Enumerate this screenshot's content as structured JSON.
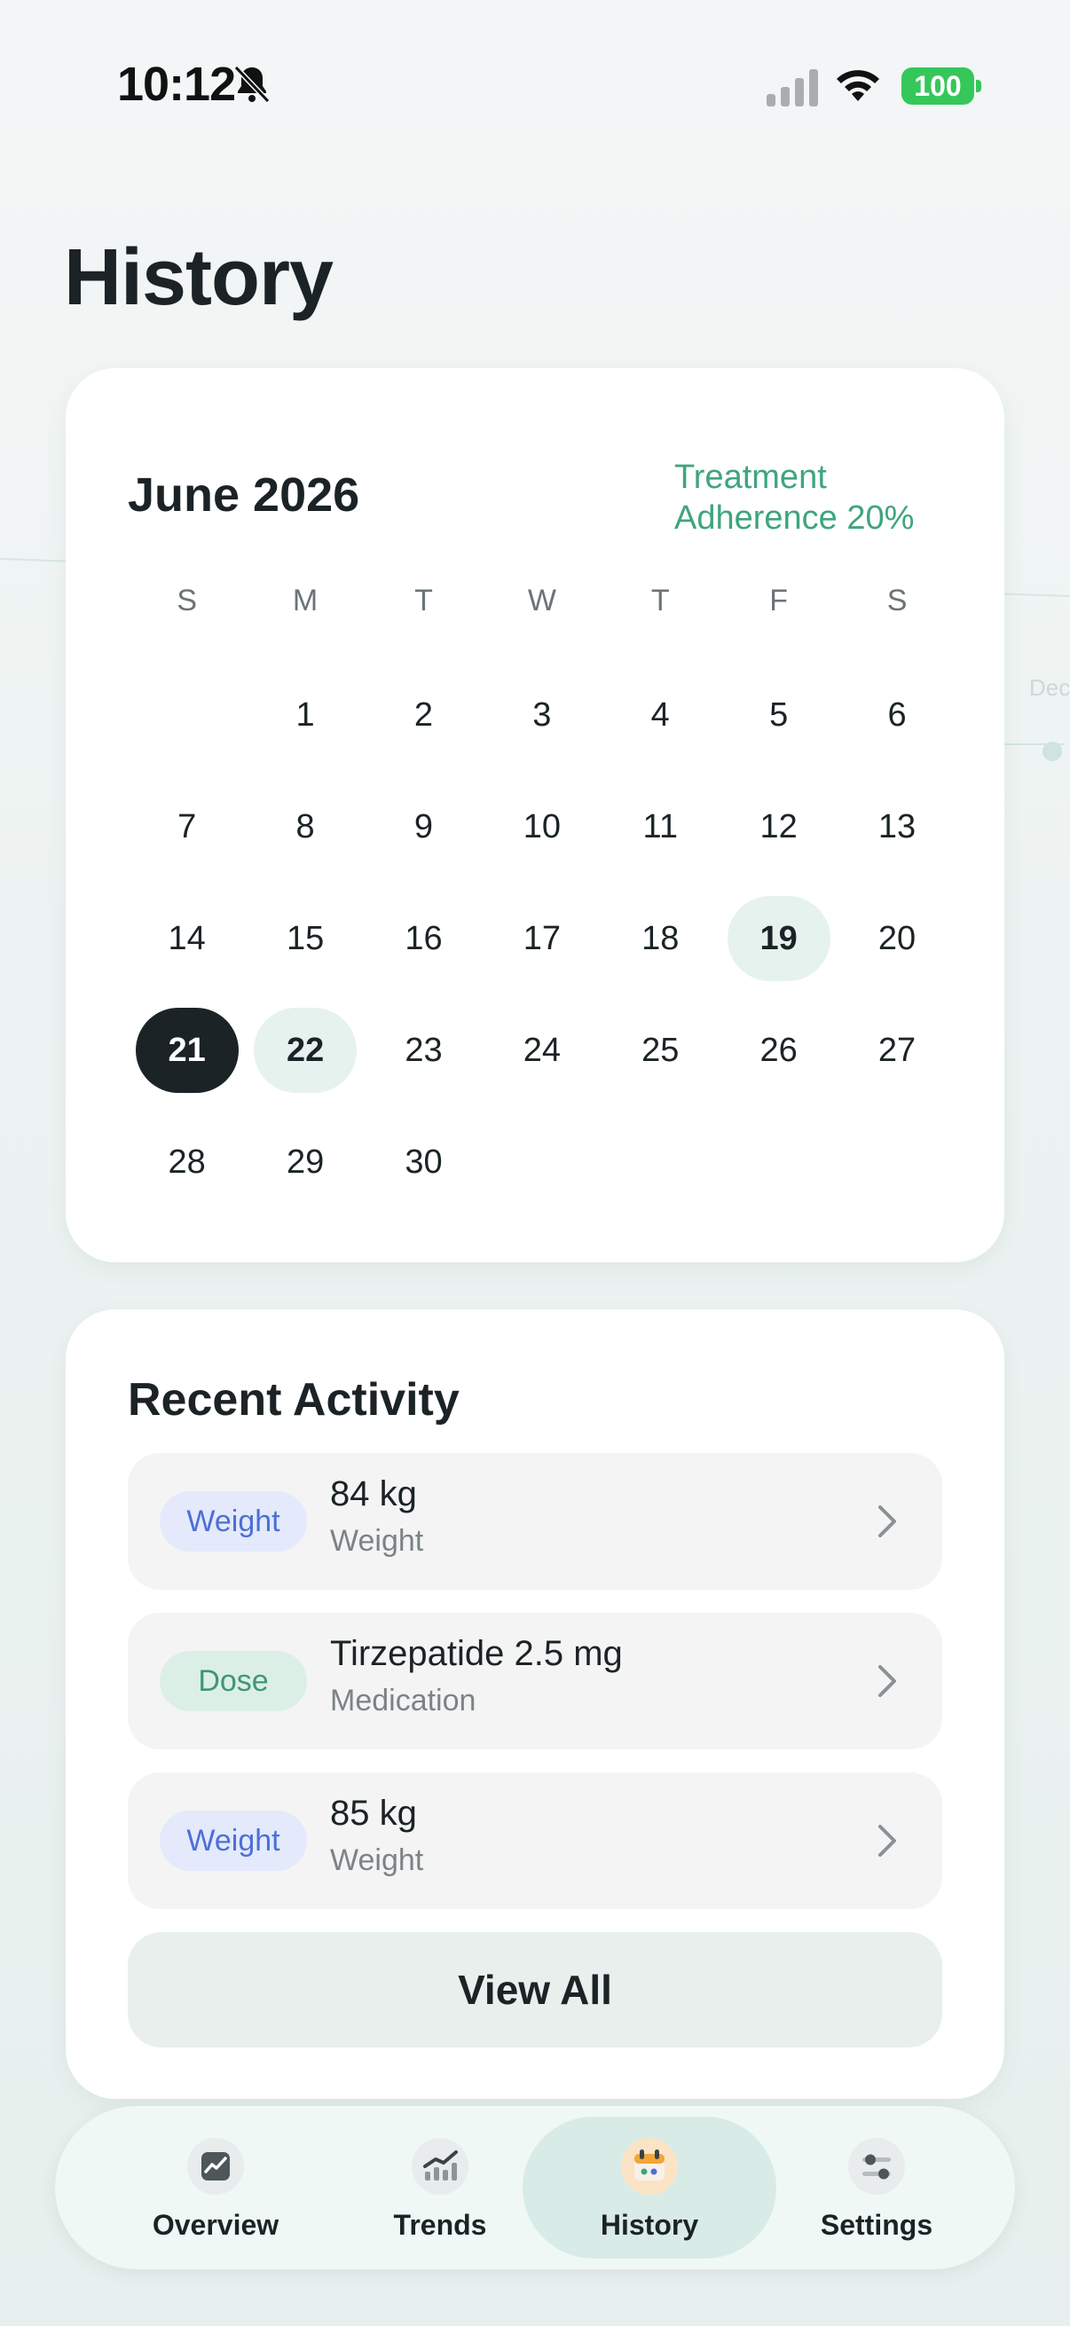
{
  "status_bar": {
    "time": "10:12",
    "battery": "100"
  },
  "page": {
    "title": "History"
  },
  "calendar": {
    "month_label": "June 2026",
    "adherence": "Treatment Adherence 20%",
    "weekdays": [
      "S",
      "M",
      "T",
      "W",
      "T",
      "F",
      "S"
    ],
    "weeks": [
      [
        "",
        "1",
        "2",
        "3",
        "4",
        "5",
        "6"
      ],
      [
        "7",
        "8",
        "9",
        "10",
        "11",
        "12",
        "13"
      ],
      [
        "14",
        "15",
        "16",
        "17",
        "18",
        "19",
        "20"
      ],
      [
        "21",
        "22",
        "23",
        "24",
        "25",
        "26",
        "27"
      ],
      [
        "28",
        "29",
        "30",
        "",
        "",
        "",
        ""
      ]
    ],
    "selected_day": "21",
    "highlighted_days": [
      "19",
      "22"
    ]
  },
  "recent_activity": {
    "title": "Recent Activity",
    "items": [
      {
        "tag": "Weight",
        "tag_type": "weight",
        "value": "84 kg",
        "category": "Weight"
      },
      {
        "tag": "Dose",
        "tag_type": "dose",
        "value": "Tirzepatide 2.5 mg",
        "category": "Medication"
      },
      {
        "tag": "Weight",
        "tag_type": "weight",
        "value": "85 kg",
        "category": "Weight"
      }
    ],
    "view_all_label": "View All"
  },
  "nav": {
    "items": [
      {
        "label": "Overview",
        "icon": "overview-chart-icon"
      },
      {
        "label": "Trends",
        "icon": "trends-chart-icon"
      },
      {
        "label": "History",
        "icon": "history-calendar-icon"
      },
      {
        "label": "Settings",
        "icon": "settings-sliders-icon"
      }
    ],
    "active": "History"
  },
  "colors": {
    "accent_green": "#3fa57c",
    "dark": "#1b2326",
    "weight_tag": "#4b70d6",
    "dose_tag": "#3f9775",
    "battery": "#35c759"
  }
}
